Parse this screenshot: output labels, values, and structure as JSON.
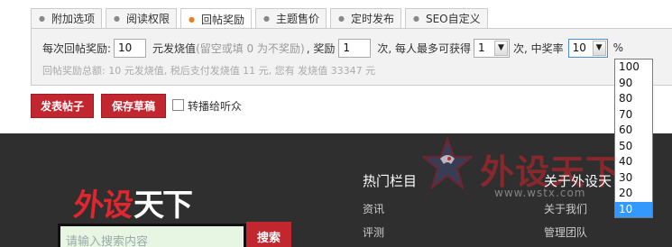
{
  "tabs": [
    "附加选项",
    "阅读权限",
    "回帖奖励",
    "主题售价",
    "定时发布",
    "SEO自定义"
  ],
  "reward": {
    "label_prefix": "每次回帖奖励:",
    "amount_value": "10",
    "label_value": "元发烧值",
    "hint": "(留空或填 0 为不奖励)",
    "label_reward": ", 奖励",
    "times_value": "1",
    "label_times_max": "次, 每人最多可获得",
    "max_select": "1",
    "label_times_rate": "次, 中奖率",
    "rate_select": "10",
    "percent": "%",
    "summary": "回帖奖励总额: 10 元发烧值, 税后支付发烧值 11 元, 您有 发烧值 33347 元"
  },
  "rate_options": [
    "100",
    "90",
    "80",
    "70",
    "60",
    "50",
    "40",
    "30",
    "20",
    "10"
  ],
  "actions": {
    "publish": "发表帖子",
    "save_draft": "保存草稿",
    "broadcast_label": "转播给听众"
  },
  "footer": {
    "logo_red": "外设",
    "logo_white": "天下",
    "search_placeholder": "请输入搜索内容",
    "search_button": "搜索",
    "hot_title": "热门栏目",
    "hot_items": [
      "资讯",
      "评测"
    ],
    "about_title": "关于外设天",
    "about_items": [
      "关于我们",
      "管理团队"
    ],
    "watermark_text": "外设天下",
    "watermark_url": "www.wstx.com"
  },
  "colors": {
    "brand_red": "#c2262e",
    "footer_bg": "#2f2f2f",
    "selection_blue": "#3399ff"
  }
}
